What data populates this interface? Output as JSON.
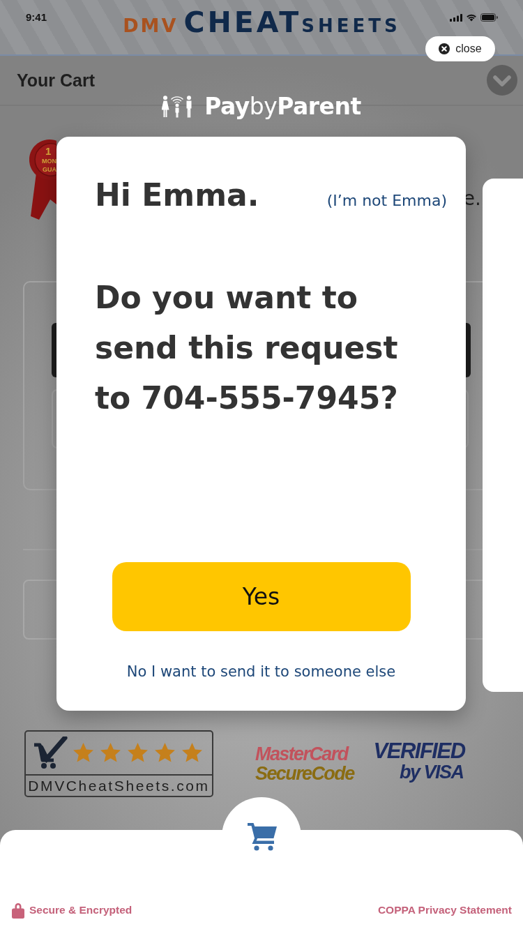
{
  "status_bar": {
    "time": "9:41"
  },
  "site_header": {
    "logo": [
      {
        "text": "DMV",
        "color": "#a9521f"
      },
      {
        "text": "CHEAT",
        "color": "#10294a"
      },
      {
        "text": "SHEETS",
        "color": "#10294a"
      }
    ]
  },
  "cart_header": {
    "title": "Your Cart"
  },
  "background": {
    "medal_lines": [
      "1",
      "MON",
      "GUA"
    ],
    "heading_fragment": "e."
  },
  "trust_badges": {
    "rating": {
      "stars": 5,
      "site": "DMVCheatSheets.com"
    },
    "mastercard": [
      "MasterCard",
      "SecureCode"
    ],
    "visa": [
      "VERIFIED",
      "by VISA"
    ]
  },
  "overlay": {
    "close": "close",
    "brand": "**Pay**by**Parent**"
  },
  "dialog": {
    "greeting": "Hi Emma.",
    "not_me": "(I’m not Emma)",
    "question": "Do you want to send this request to 704-555-7945?",
    "confirm": "Yes",
    "decline": "No I want to send it to someone else"
  },
  "footer": {
    "security": "Secure & Encrypted",
    "privacy": "COPPA Privacy Statement"
  }
}
